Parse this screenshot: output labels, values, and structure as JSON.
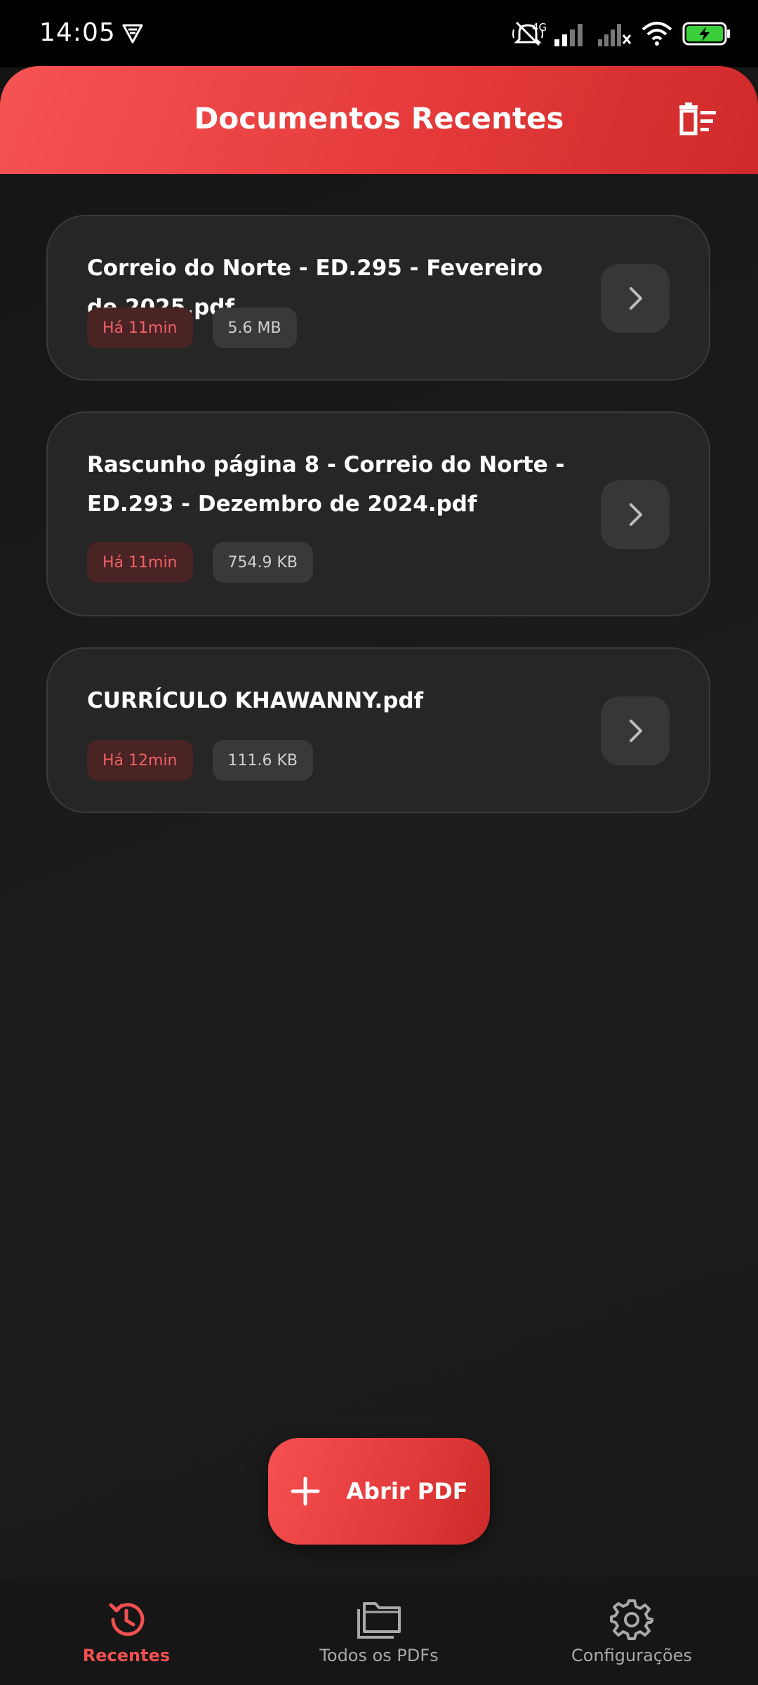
{
  "status_bar": {
    "time": "14:05",
    "network": "4G",
    "icons": [
      "vpn-icon",
      "silent-icon",
      "signal-icon",
      "signal-off-icon",
      "wifi-icon",
      "battery-charging-icon"
    ]
  },
  "header": {
    "title": "Documentos Recentes",
    "clear_icon": "clear-all-icon"
  },
  "documents": [
    {
      "title": "Correio do Norte - ED.295 - Fevereiro de 2025.pdf",
      "time": "Há 11min",
      "size": "5.6 MB"
    },
    {
      "title": "Rascunho página 8 - Correio do Norte - ED.293 - Dezembro de 2024.pdf",
      "time": "Há 11min",
      "size": "754.9 KB"
    },
    {
      "title": "CURRÍCULO KHAWANNY.pdf",
      "time": "Há 12min",
      "size": "111.6 KB"
    }
  ],
  "fab": {
    "label": "Abrir PDF",
    "icon": "plus-icon"
  },
  "bottom_nav": [
    {
      "label": "Recentes",
      "icon": "history-icon",
      "active": true
    },
    {
      "label": "Todos os PDFs",
      "icon": "folders-icon",
      "active": false
    },
    {
      "label": "Configurações",
      "icon": "gear-icon",
      "active": false
    }
  ],
  "colors": {
    "accent": "#e53a3a",
    "background": "#1a1a1a",
    "card": "#262626",
    "tag_time_bg": "#4a2325",
    "tag_time_text": "#f06262"
  }
}
